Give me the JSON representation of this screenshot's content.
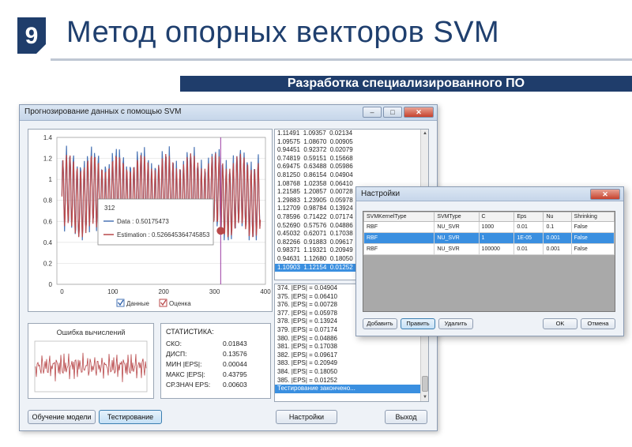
{
  "slide": {
    "number": "9",
    "title": "Метод опорных векторов SVM",
    "subtitle": "Разработка специализированного ПО"
  },
  "main_window": {
    "title": "Прогнозирование данных с помощью SVM",
    "controls": {
      "minimize": "–",
      "maximize": "□",
      "close": "✕"
    },
    "buttons": {
      "train": "Обучение модели",
      "test": "Тестирование",
      "settings": "Настройки",
      "exit": "Выход"
    }
  },
  "chart_data": {
    "type": "line",
    "x_ticks": [
      "0",
      "100",
      "200",
      "300",
      "400"
    ],
    "y_ticks": [
      "0",
      "0.2",
      "0.4",
      "0.6",
      "0.8",
      "1",
      "1.2",
      "1.4"
    ],
    "xlim": [
      -10,
      400
    ],
    "ylim": [
      0,
      1.4
    ],
    "series": [
      {
        "name": "Данные",
        "color": "#4a74b5"
      },
      {
        "name": "Оценка",
        "color": "#b8484a"
      }
    ],
    "cursor_x": 312,
    "tooltip": {
      "header": "312",
      "data_label": "Data : 0.50175473",
      "estimation_label": "Estimation : 0.526645364745853"
    }
  },
  "results_list": [
    "1.11491  1.09357  0.02134",
    "1.09575  1.08670  0.00905",
    "0.94451  0.92372  0.02079",
    "0.74819  0.59151  0.15668",
    "0.69475  0.63488  0.05986",
    "0.81250  0.86154  0.04904",
    "1.08768  1.02358  0.06410",
    "1.21585  1.20857  0.00728",
    "1.29883  1.23905  0.05978",
    "1.12709  0.98784  0.13924",
    "0.78596  0.71422  0.07174",
    "0.52690  0.57576  0.04886",
    "0.45032  0.62071  0.17038",
    "0.82266  0.91883  0.09617",
    "0.98371  1.19321  0.20949",
    "0.94631  1.12680  0.18050",
    "1.10903  1.12154  0.01252"
  ],
  "eps_list": [
    "374. |EPS| = 0.04904",
    "375. |EPS| = 0.06410",
    "376. |EPS| = 0.00728",
    "377. |EPS| = 0.05978",
    "378. |EPS| = 0.13924",
    "379. |EPS| = 0.07174",
    "380. |EPS| = 0.04886",
    "381. |EPS| = 0.17038",
    "382. |EPS| = 0.09617",
    "383. |EPS| = 0.20949",
    "384. |EPS| = 0.18050",
    "385. |EPS| = 0.01252",
    "Тестирование закончено..."
  ],
  "error_panel": {
    "title": "Ошибка вычислений"
  },
  "stats": {
    "title": "СТАТИСТИКА:",
    "rows": [
      {
        "label": "СКО:",
        "value": "0.01843"
      },
      {
        "label": "ДИСП:",
        "value": "0.13576"
      },
      {
        "label": "МИН |EPS|:",
        "value": "0.00044"
      },
      {
        "label": "МАКС |EPS|:",
        "value": "0.43795"
      },
      {
        "label": "СР.ЗНАЧ EPS:",
        "value": "0.00603"
      }
    ]
  },
  "settings_dialog": {
    "title": "Настройки",
    "close": "✕",
    "columns": [
      "SVMKernelType",
      "SVMType",
      "C",
      "Eps",
      "Nu",
      "Shrinking"
    ],
    "rows": [
      [
        "RBF",
        "NU_SVR",
        "1000",
        "0.01",
        "0.1",
        "False"
      ],
      [
        "RBF",
        "NU_SVR",
        "1",
        "1E-05",
        "0.001",
        "False"
      ],
      [
        "RBF",
        "NU_SVR",
        "100000",
        "0.01",
        "0.001",
        "False"
      ]
    ],
    "buttons": {
      "add": "Добавить",
      "edit": "Править",
      "delete": "Удалить",
      "ok": "OK",
      "cancel": "Отмена"
    }
  }
}
